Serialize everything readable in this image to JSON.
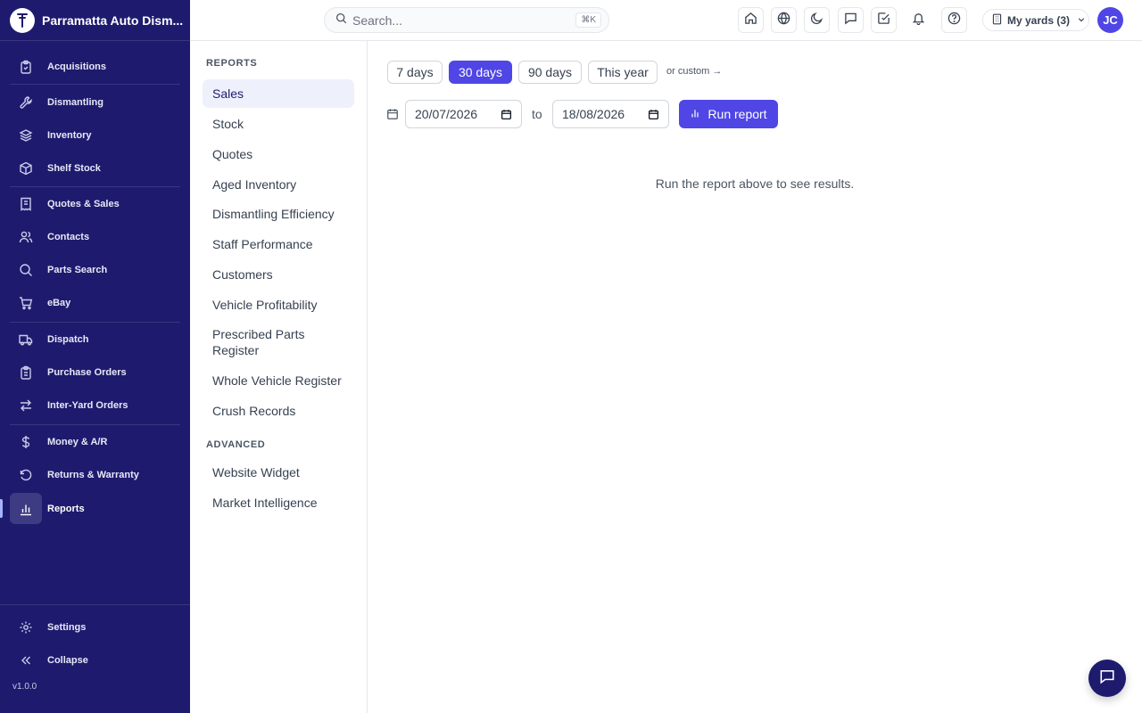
{
  "app": {
    "name": "Parramatta Auto Dism...",
    "version": "v1.0.0"
  },
  "sidebar": {
    "items": [
      {
        "label": "Acquisitions",
        "icon": "clipboard-icon"
      },
      {
        "label": "Dismantling",
        "icon": "wrench-icon"
      },
      {
        "label": "Inventory",
        "icon": "layers-icon"
      },
      {
        "label": "Shelf Stock",
        "icon": "box-icon"
      },
      {
        "label": "Quotes & Sales",
        "icon": "receipt-icon"
      },
      {
        "label": "Contacts",
        "icon": "users-icon"
      },
      {
        "label": "Parts Search",
        "icon": "search-icon"
      },
      {
        "label": "eBay",
        "icon": "cart-icon"
      },
      {
        "label": "Dispatch",
        "icon": "truck-icon"
      },
      {
        "label": "Purchase Orders",
        "icon": "clipboard-list-icon"
      },
      {
        "label": "Inter-Yard Orders",
        "icon": "arrows-swap-icon"
      },
      {
        "label": "Money & A/R",
        "icon": "dollar-icon"
      },
      {
        "label": "Returns & Warranty",
        "icon": "rotate-ccw-icon"
      },
      {
        "label": "Reports",
        "icon": "bar-chart-icon",
        "active": true
      }
    ],
    "settings_label": "Settings",
    "collapse_label": "Collapse"
  },
  "topbar": {
    "search_placeholder": "Search...",
    "search_shortcut": "⌘K",
    "yards_label": "My yards (3)",
    "avatar_initials": "JC"
  },
  "reports_nav": {
    "heading": "REPORTS",
    "items": [
      "Sales",
      "Stock",
      "Quotes",
      "Aged Inventory",
      "Dismantling Efficiency",
      "Staff Performance",
      "Customers",
      "Vehicle Profitability",
      "Prescribed Parts Register",
      "Whole Vehicle Register",
      "Crush Records"
    ],
    "active_item": "Sales",
    "advanced_heading": "ADVANCED",
    "advanced_items": [
      "Website Widget",
      "Market Intelligence"
    ]
  },
  "report": {
    "ranges": [
      "7 days",
      "30 days",
      "90 days",
      "This year"
    ],
    "active_range": "30 days",
    "custom_link": "or custom →",
    "from_date": "20/07/2026",
    "to_label": "to",
    "to_date": "18/08/2026",
    "run_label": "Run report",
    "empty_message": "Run the report above to see results."
  },
  "colors": {
    "sidebar_bg": "#1e1b6e",
    "accent": "#4f46e5",
    "active_subnav_bg": "#eef0fb"
  }
}
